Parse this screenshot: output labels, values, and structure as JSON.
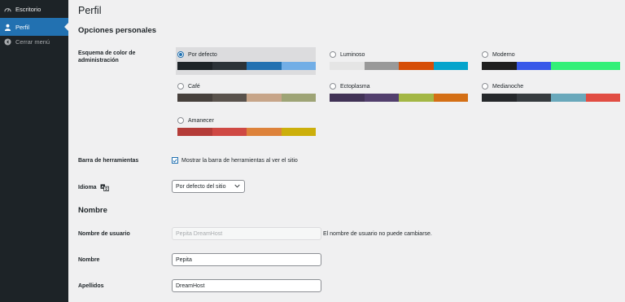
{
  "sidebar": {
    "items": [
      {
        "label": "Escritorio",
        "icon": "dashboard-icon"
      },
      {
        "label": "Perfil",
        "icon": "user-icon"
      },
      {
        "label": "Cerrar menú",
        "icon": "collapse-icon"
      }
    ],
    "bg": "#1d2327",
    "active_bg": "#2271b1"
  },
  "page": {
    "title": "Perfil",
    "personal_options_title": "Opciones personales",
    "color_scheme_label": "Esquema de color de administración",
    "toolbar_label": "Barra de herramientas",
    "toolbar_checkbox_label": "Mostrar la barra de herramientas al ver el sitio",
    "toolbar_checked": true,
    "language_label": "Idioma",
    "language_value": "Por defecto del sitio",
    "name_section_title": "Nombre",
    "username_label": "Nombre de usuario",
    "username_value": "Pepita DreamHost",
    "username_note": "El nombre de usuario no puede cambiarse.",
    "first_name_label": "Nombre",
    "first_name_value": "Pepita",
    "last_name_label": "Apellidos",
    "last_name_value": "DreamHost"
  },
  "schemes": [
    {
      "label": "Por defecto",
      "selected": true,
      "colors": [
        "#1d2327",
        "#2c3338",
        "#2271b1",
        "#72aee6"
      ]
    },
    {
      "label": "Luminoso",
      "selected": false,
      "colors": [
        "#e5e5e5",
        "#999999",
        "#d64e07",
        "#04a4cc"
      ]
    },
    {
      "label": "Moderno",
      "selected": false,
      "colors": [
        "#1e1e1e",
        "#3858e9",
        "#33f078",
        "#33f078"
      ]
    },
    {
      "label": "Café",
      "selected": false,
      "colors": [
        "#46403c",
        "#59524c",
        "#c7a589",
        "#9ea476"
      ]
    },
    {
      "label": "Ectoplasma",
      "selected": false,
      "colors": [
        "#413256",
        "#523f6d",
        "#a3b745",
        "#d46f15"
      ]
    },
    {
      "label": "Medianoche",
      "selected": false,
      "colors": [
        "#25282b",
        "#363b3f",
        "#69a8bb",
        "#e14d43"
      ]
    },
    {
      "label": "Amanecer",
      "selected": false,
      "colors": [
        "#b43c38",
        "#cf4944",
        "#dd823b",
        "#ccaf0b"
      ]
    }
  ]
}
